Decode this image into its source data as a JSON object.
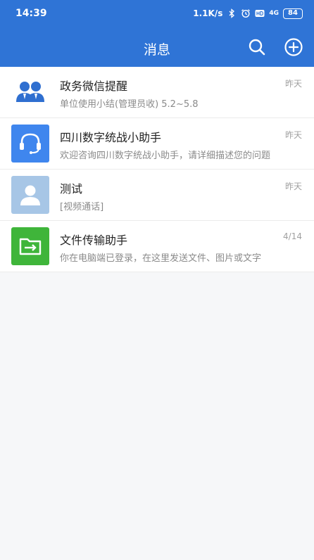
{
  "status_bar": {
    "time": "14:39",
    "net_speed": "1.1K/s",
    "network": "4G",
    "battery": "84"
  },
  "header": {
    "title": "消息",
    "accent_color": "#2f74d6"
  },
  "conversations": [
    {
      "name": "政务微信提醒",
      "preview": "单位使用小结(管理员收) 5.2~5.8",
      "time": "昨天",
      "avatar_icon": "group-users-icon",
      "avatar_color": "#ffffff"
    },
    {
      "name": "四川数字统战小助手",
      "preview": "欢迎咨询四川数字统战小助手，请详细描述您的问题",
      "time": "昨天",
      "avatar_icon": "headset-icon",
      "avatar_color": "#3f86ee"
    },
    {
      "name": "测试",
      "preview": "[视频通话]",
      "time": "昨天",
      "avatar_icon": "person-icon",
      "avatar_color": "#a7c6e6"
    },
    {
      "name": "文件传输助手",
      "preview": "你在电脑端已登录，在这里发送文件、图片或文字",
      "time": "4/14",
      "avatar_icon": "folder-transfer-icon",
      "avatar_color": "#3fb53a"
    }
  ]
}
